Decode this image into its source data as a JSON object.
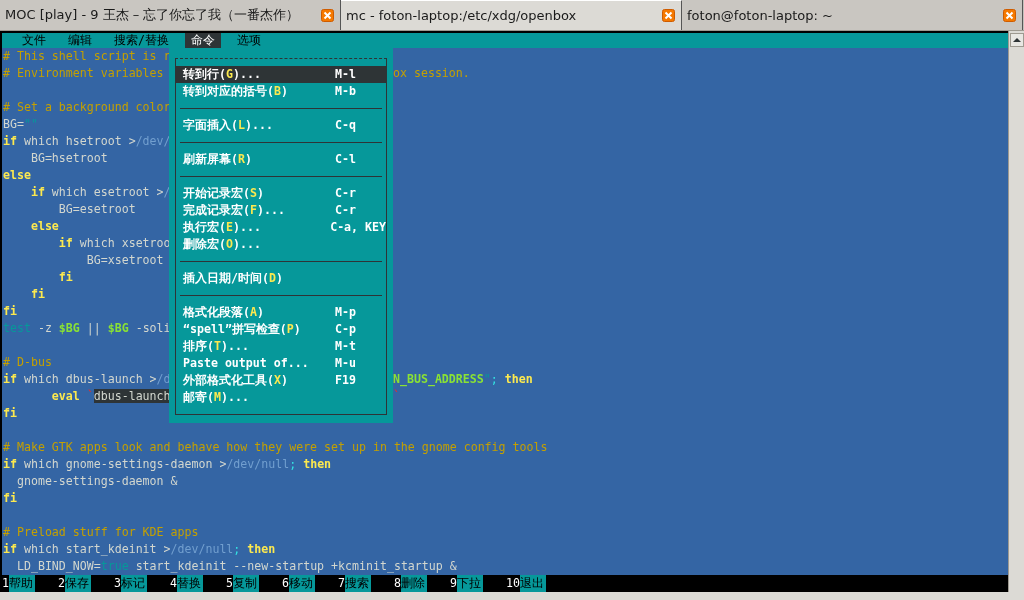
{
  "tabs": [
    {
      "title": "MOC [play] - 9 王杰 – 忘了你忘了我（一番杰作）",
      "selected": false
    },
    {
      "title": "mc - foton-laptop:/etc/xdg/openbox",
      "selected": true
    },
    {
      "title": "foton@foton-laptop: ~",
      "selected": false
    }
  ],
  "menu_bar": [
    {
      "label": "文件",
      "selected": false
    },
    {
      "label": "编辑",
      "selected": false
    },
    {
      "label": "搜索/替换",
      "selected": false
    },
    {
      "label": "命令",
      "selected": true
    },
    {
      "label": "选项",
      "selected": false
    }
  ],
  "code_lines": [
    {
      "kind": "code",
      "left": [
        {
          "t": "# This shell script is r",
          "kind": "comment"
        }
      ]
    },
    {
      "kind": "code",
      "left": [
        {
          "t": "# Environment variables",
          "kind": "comment"
        }
      ],
      "right": [
        {
          "t": "ox session.",
          "kind": "comment"
        }
      ]
    },
    {
      "kind": "blank"
    },
    {
      "kind": "code",
      "left": [
        {
          "t": "# Set a background color",
          "kind": "comment"
        }
      ]
    },
    {
      "kind": "code",
      "left": [
        {
          "t": "BG=",
          "kind": "plain"
        },
        {
          "t": "\"\"",
          "kind": "string"
        }
      ]
    },
    {
      "kind": "code",
      "left": [
        {
          "t": "if",
          "kind": "keyword"
        },
        {
          "t": " which hsetroot >",
          "kind": "plain"
        },
        {
          "t": "/dev/",
          "kind": "path"
        }
      ]
    },
    {
      "kind": "code",
      "left": [
        {
          "t": "    BG=hsetroot",
          "kind": "plain"
        }
      ]
    },
    {
      "kind": "code",
      "left": [
        {
          "t": "else",
          "kind": "keyword"
        }
      ]
    },
    {
      "kind": "code",
      "left": [
        {
          "t": "    if",
          "kind": "keyword"
        },
        {
          "t": " which esetroot >",
          "kind": "plain"
        },
        {
          "t": "/",
          "kind": "path"
        }
      ]
    },
    {
      "kind": "code",
      "left": [
        {
          "t": "        BG=esetroot",
          "kind": "plain"
        }
      ]
    },
    {
      "kind": "code",
      "left": [
        {
          "t": "    else",
          "kind": "keyword"
        }
      ]
    },
    {
      "kind": "code",
      "left": [
        {
          "t": "        if",
          "kind": "keyword"
        },
        {
          "t": " which xsetroo",
          "kind": "plain"
        }
      ]
    },
    {
      "kind": "code",
      "left": [
        {
          "t": "            BG=xsetroot",
          "kind": "plain"
        }
      ]
    },
    {
      "kind": "code",
      "left": [
        {
          "t": "        fi",
          "kind": "keyword"
        }
      ]
    },
    {
      "kind": "code",
      "left": [
        {
          "t": "    fi",
          "kind": "keyword"
        }
      ]
    },
    {
      "kind": "code",
      "left": [
        {
          "t": "fi",
          "kind": "keyword"
        }
      ]
    },
    {
      "kind": "code",
      "left": [
        {
          "t": "test",
          "kind": "builtin"
        },
        {
          "t": " -z ",
          "kind": "plain"
        },
        {
          "t": "$BG",
          "kind": "var"
        },
        {
          "t": " || ",
          "kind": "plain"
        },
        {
          "t": "$BG",
          "kind": "var"
        },
        {
          "t": " -soli",
          "kind": "plain"
        }
      ]
    },
    {
      "kind": "blank"
    },
    {
      "kind": "code",
      "left": [
        {
          "t": "# D-bus",
          "kind": "comment"
        }
      ]
    },
    {
      "kind": "code",
      "left": [
        {
          "t": "if",
          "kind": "keyword"
        },
        {
          "t": " which dbus-launch >",
          "kind": "plain"
        },
        {
          "t": "/d",
          "kind": "path"
        }
      ],
      "right": [
        {
          "t": "N_BUS_ADDRESS",
          "kind": "var"
        },
        {
          "t": "\"",
          "kind": "string"
        },
        {
          "t": ";",
          "kind": "op"
        },
        {
          "t": " then",
          "kind": "keyword"
        }
      ]
    },
    {
      "kind": "code",
      "left": [
        {
          "t": "       eval ",
          "kind": "keyword"
        },
        {
          "t": "`",
          "kind": "mark"
        },
        {
          "t": "dbus-launch",
          "kind": "selection"
        }
      ],
      "right": [
        {
          "t": "`",
          "kind": "mark"
        }
      ]
    },
    {
      "kind": "code",
      "left": [
        {
          "t": "fi",
          "kind": "keyword"
        }
      ]
    },
    {
      "kind": "blank"
    },
    {
      "kind": "code",
      "left": [
        {
          "t": "# Make GTK apps look and behave how they were set up in the gnome config tools",
          "kind": "comment"
        }
      ]
    },
    {
      "kind": "code",
      "left": [
        {
          "t": "if",
          "kind": "keyword"
        },
        {
          "t": " which gnome-settings-daemon >",
          "kind": "plain"
        },
        {
          "t": "/dev/null",
          "kind": "path"
        },
        {
          "t": ";",
          "kind": "op"
        },
        {
          "t": " then",
          "kind": "keyword"
        }
      ]
    },
    {
      "kind": "code",
      "left": [
        {
          "t": "  gnome-settings-daemon &",
          "kind": "plain"
        }
      ]
    },
    {
      "kind": "code",
      "left": [
        {
          "t": "fi",
          "kind": "keyword"
        }
      ]
    },
    {
      "kind": "blank"
    },
    {
      "kind": "code",
      "left": [
        {
          "t": "# Preload stuff for KDE apps",
          "kind": "comment"
        }
      ]
    },
    {
      "kind": "code",
      "left": [
        {
          "t": "if",
          "kind": "keyword"
        },
        {
          "t": " which start_kdeinit >",
          "kind": "plain"
        },
        {
          "t": "/dev/null",
          "kind": "path"
        },
        {
          "t": ";",
          "kind": "op"
        },
        {
          "t": " then",
          "kind": "keyword"
        }
      ]
    },
    {
      "kind": "code",
      "left": [
        {
          "t": "  LD_BIND_NOW=",
          "kind": "plain"
        },
        {
          "t": "true",
          "kind": "builtin"
        },
        {
          "t": " start_kdeinit --new-startup +kcminit_startup &",
          "kind": "plain"
        }
      ]
    }
  ],
  "command_menu": {
    "items": [
      {
        "kind": "item",
        "pre": "转到行(",
        "hotkey": "G",
        "post": ")...",
        "shortcut": "M-l",
        "selected": true
      },
      {
        "kind": "item",
        "pre": "转到对应的括号(",
        "hotkey": "B",
        "post": ")",
        "shortcut": "M-b",
        "selected": false
      },
      {
        "kind": "separator"
      },
      {
        "kind": "item",
        "pre": "字面插入(",
        "hotkey": "L",
        "post": ")...",
        "shortcut": "C-q",
        "selected": false
      },
      {
        "kind": "separator"
      },
      {
        "kind": "item",
        "pre": "刷新屏幕(",
        "hotkey": "R",
        "post": ")",
        "shortcut": "C-l",
        "selected": false
      },
      {
        "kind": "separator"
      },
      {
        "kind": "item",
        "pre": "开始记录宏(",
        "hotkey": "S",
        "post": ")",
        "shortcut": "C-r",
        "selected": false
      },
      {
        "kind": "item",
        "pre": "完成记录宏(",
        "hotkey": "F",
        "post": ")...",
        "shortcut": "C-r",
        "selected": false
      },
      {
        "kind": "item",
        "pre": "执行宏(",
        "hotkey": "E",
        "post": ")...",
        "shortcut": "C-a, KEY",
        "selected": false
      },
      {
        "kind": "item",
        "pre": "删除宏(",
        "hotkey": "O",
        "post": ")...",
        "selected": false
      },
      {
        "kind": "separator"
      },
      {
        "kind": "item",
        "pre": "插入日期/时间(",
        "hotkey": "D",
        "post": ")",
        "selected": false
      },
      {
        "kind": "separator"
      },
      {
        "kind": "item",
        "pre": "格式化段落(",
        "hotkey": "A",
        "post": ")",
        "shortcut": "M-p",
        "selected": false
      },
      {
        "kind": "item",
        "pre": "“spell”拼写检查(",
        "hotkey": "P",
        "post": ")",
        "shortcut": "C-p",
        "selected": false
      },
      {
        "kind": "item",
        "pre": "排序(",
        "hotkey": "T",
        "post": ")...",
        "shortcut": "M-t",
        "selected": false
      },
      {
        "kind": "item",
        "pre": "Paste output of...",
        "shortcut": "M-u",
        "selected": false
      },
      {
        "kind": "item",
        "pre": "外部格式化工具(",
        "hotkey": "X",
        "post": ")",
        "shortcut": "F19",
        "selected": false
      },
      {
        "kind": "item",
        "pre": "邮寄(",
        "hotkey": "M",
        "post": ")...",
        "selected": false
      }
    ]
  },
  "function_keys": [
    {
      "number": "1",
      "label": "帮助"
    },
    {
      "number": "2",
      "label": "保存"
    },
    {
      "number": "3",
      "label": "标记"
    },
    {
      "number": "4",
      "label": "替换"
    },
    {
      "number": "5",
      "label": "复制"
    },
    {
      "number": "6",
      "label": "移动"
    },
    {
      "number": "7",
      "label": "搜索"
    },
    {
      "number": "8",
      "label": "删除"
    },
    {
      "number": "9",
      "label": "下拉"
    },
    {
      "number": "10",
      "label": "退出"
    }
  ]
}
